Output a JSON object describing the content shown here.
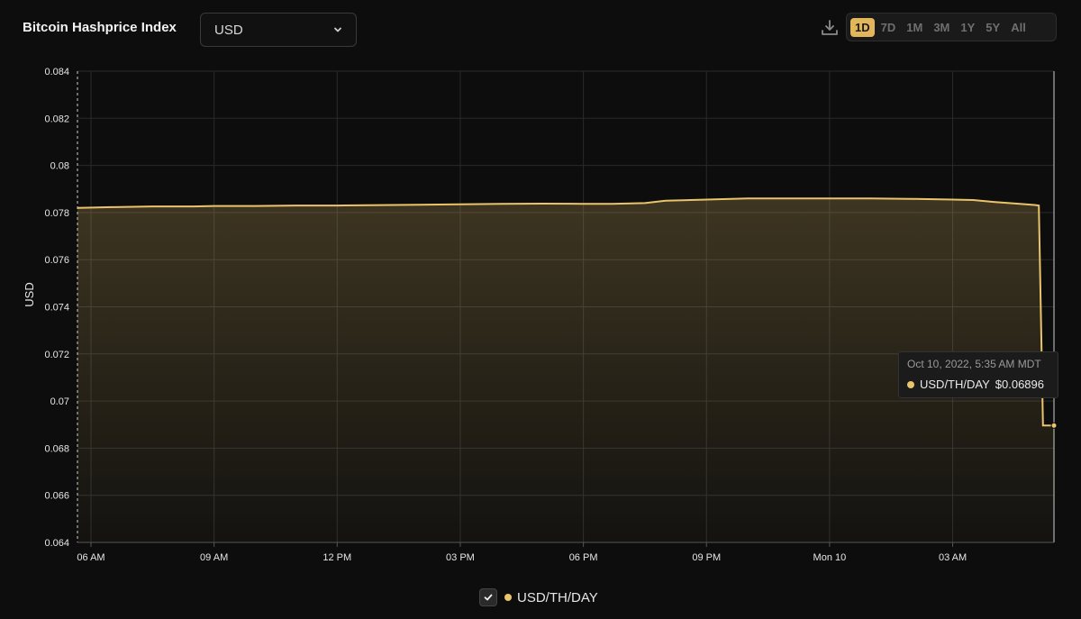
{
  "header": {
    "title": "Bitcoin Hashprice Index",
    "currency": "USD",
    "ranges": [
      "1D",
      "7D",
      "1M",
      "3M",
      "1Y",
      "5Y",
      "All"
    ],
    "active_range": "1D"
  },
  "tooltip": {
    "date": "Oct 10, 2022, 5:35 AM MDT",
    "label": "USD/TH/DAY",
    "value": "$0.06896"
  },
  "legend": {
    "label": "USD/TH/DAY",
    "checked": true
  },
  "colors": {
    "series": "#e9c46a",
    "background": "#0d0d0d",
    "grid": "#2a2a2a"
  },
  "chart_data": {
    "type": "area",
    "ylabel": "USD",
    "ylim": [
      0.064,
      0.084
    ],
    "yticks": [
      "0.084",
      "0.082",
      "0.08",
      "0.078",
      "0.076",
      "0.074",
      "0.072",
      "0.07",
      "0.068",
      "0.066",
      "0.064"
    ],
    "xticks": [
      "06 AM",
      "09 AM",
      "12 PM",
      "03 PM",
      "06 PM",
      "09 PM",
      "Mon 10",
      "03 AM"
    ],
    "x_unit": "hours from 06 AM",
    "series": [
      {
        "name": "USD/TH/DAY",
        "x": [
          -0.35,
          0.5,
          1.5,
          2.5,
          3.0,
          4.0,
          5.0,
          6.0,
          8.0,
          9.0,
          10.0,
          11.0,
          12.0,
          12.7,
          13.5,
          14.0,
          16.0,
          17.0,
          18.0,
          19.0,
          20.0,
          21.0,
          21.5,
          22.0,
          23.0,
          23.1,
          23.2,
          24.0
        ],
        "y": [
          0.0782,
          0.07823,
          0.07826,
          0.07826,
          0.07828,
          0.07828,
          0.0783,
          0.0783,
          0.07833,
          0.07835,
          0.07837,
          0.07838,
          0.07837,
          0.07837,
          0.0784,
          0.0785,
          0.0786,
          0.0786,
          0.0786,
          0.0786,
          0.07858,
          0.07855,
          0.07853,
          0.07845,
          0.07832,
          0.0783,
          0.06896,
          0.06896
        ]
      }
    ]
  }
}
